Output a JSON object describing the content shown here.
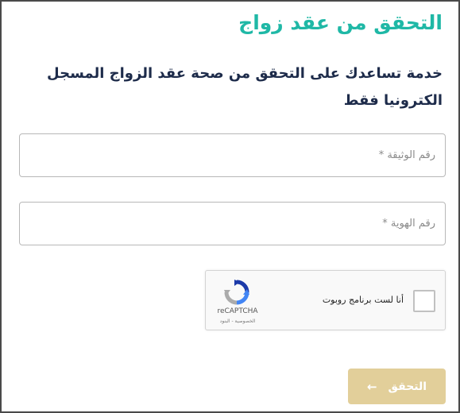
{
  "form": {
    "title": "التحقق من عقد زواج",
    "description": "خدمة تساعدك على التحقق من صحة عقد الزواج المسجل الكترونيا فقط",
    "document_number": {
      "placeholder": "رقم الوثيقة *",
      "value": ""
    },
    "id_number": {
      "placeholder": "رقم الهوية *",
      "value": ""
    },
    "submit_label": "التحقق",
    "submit_icon": "arrow-left-icon"
  },
  "recaptcha": {
    "checkbox_label": "أنا لست برنامج روبوت",
    "brand": "reCAPTCHA",
    "terms": "الخصوصية - البنود",
    "checked": false
  },
  "colors": {
    "title": "#1fb8a6",
    "description": "#1d2b4a",
    "submit_bg": "#e2cf9a"
  }
}
